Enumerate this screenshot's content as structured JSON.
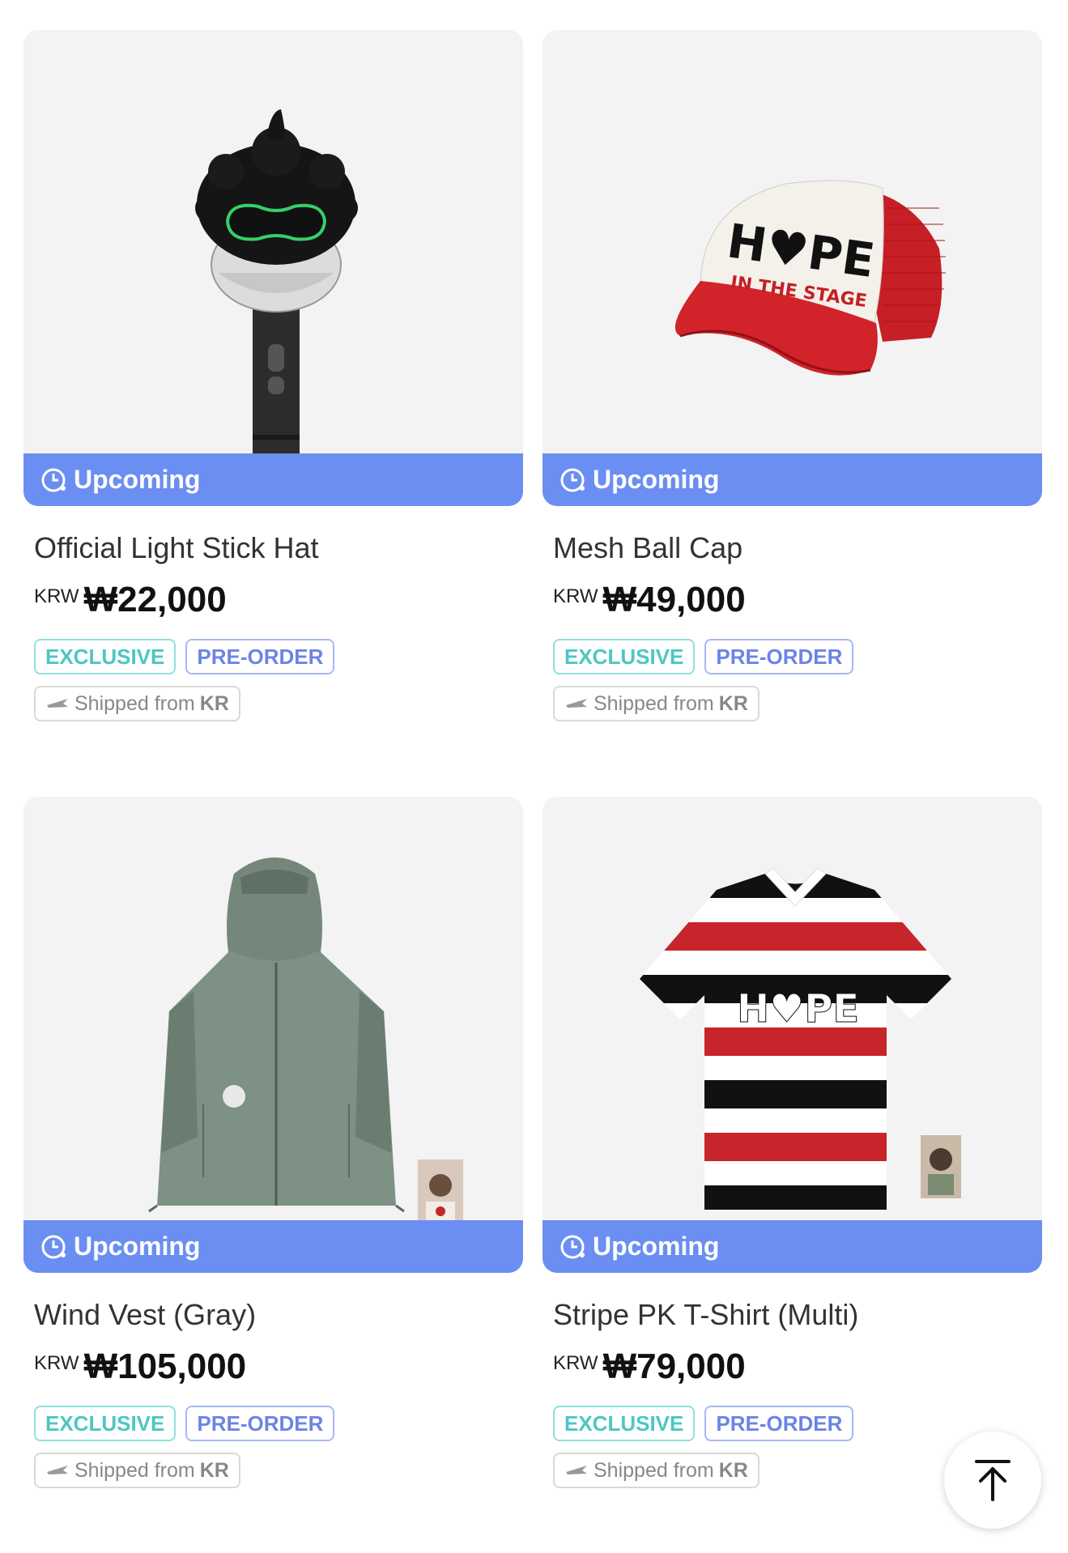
{
  "products": [
    {
      "image_icon": "light-stick-hat-image",
      "status": "Upcoming",
      "title": "Official Light Stick Hat",
      "currency": "KRW",
      "price": "₩22,000",
      "badges": [
        "EXCLUSIVE",
        "PRE-ORDER"
      ],
      "ship_prefix": "Shipped from",
      "ship_origin": "KR"
    },
    {
      "image_icon": "mesh-ball-cap-image",
      "status": "Upcoming",
      "title": "Mesh Ball Cap",
      "currency": "KRW",
      "price": "₩49,000",
      "badges": [
        "EXCLUSIVE",
        "PRE-ORDER"
      ],
      "ship_prefix": "Shipped from",
      "ship_origin": "KR"
    },
    {
      "image_icon": "wind-vest-image",
      "status": "Upcoming",
      "title": "Wind Vest (Gray)",
      "currency": "KRW",
      "price": "₩105,000",
      "badges": [
        "EXCLUSIVE",
        "PRE-ORDER"
      ],
      "ship_prefix": "Shipped from",
      "ship_origin": "KR"
    },
    {
      "image_icon": "stripe-pk-tshirt-image",
      "status": "Upcoming",
      "title": "Stripe PK T-Shirt (Multi)",
      "currency": "KRW",
      "price": "₩79,000",
      "badges": [
        "EXCLUSIVE",
        "PRE-ORDER"
      ],
      "ship_prefix": "Shipped from",
      "ship_origin": "KR"
    }
  ],
  "cap_logo_text": "H♥PE",
  "cap_sub_text": "IN THE STAGE",
  "shirt_logo_text": "H♥PE",
  "colors": {
    "status_bar": "#6b8ef2",
    "exclusive": "#4cc7c2",
    "preorder": "#6b84e6",
    "card_bg": "#f3f3f3"
  },
  "scroll_top_icon": "arrow-up-to-top-icon"
}
